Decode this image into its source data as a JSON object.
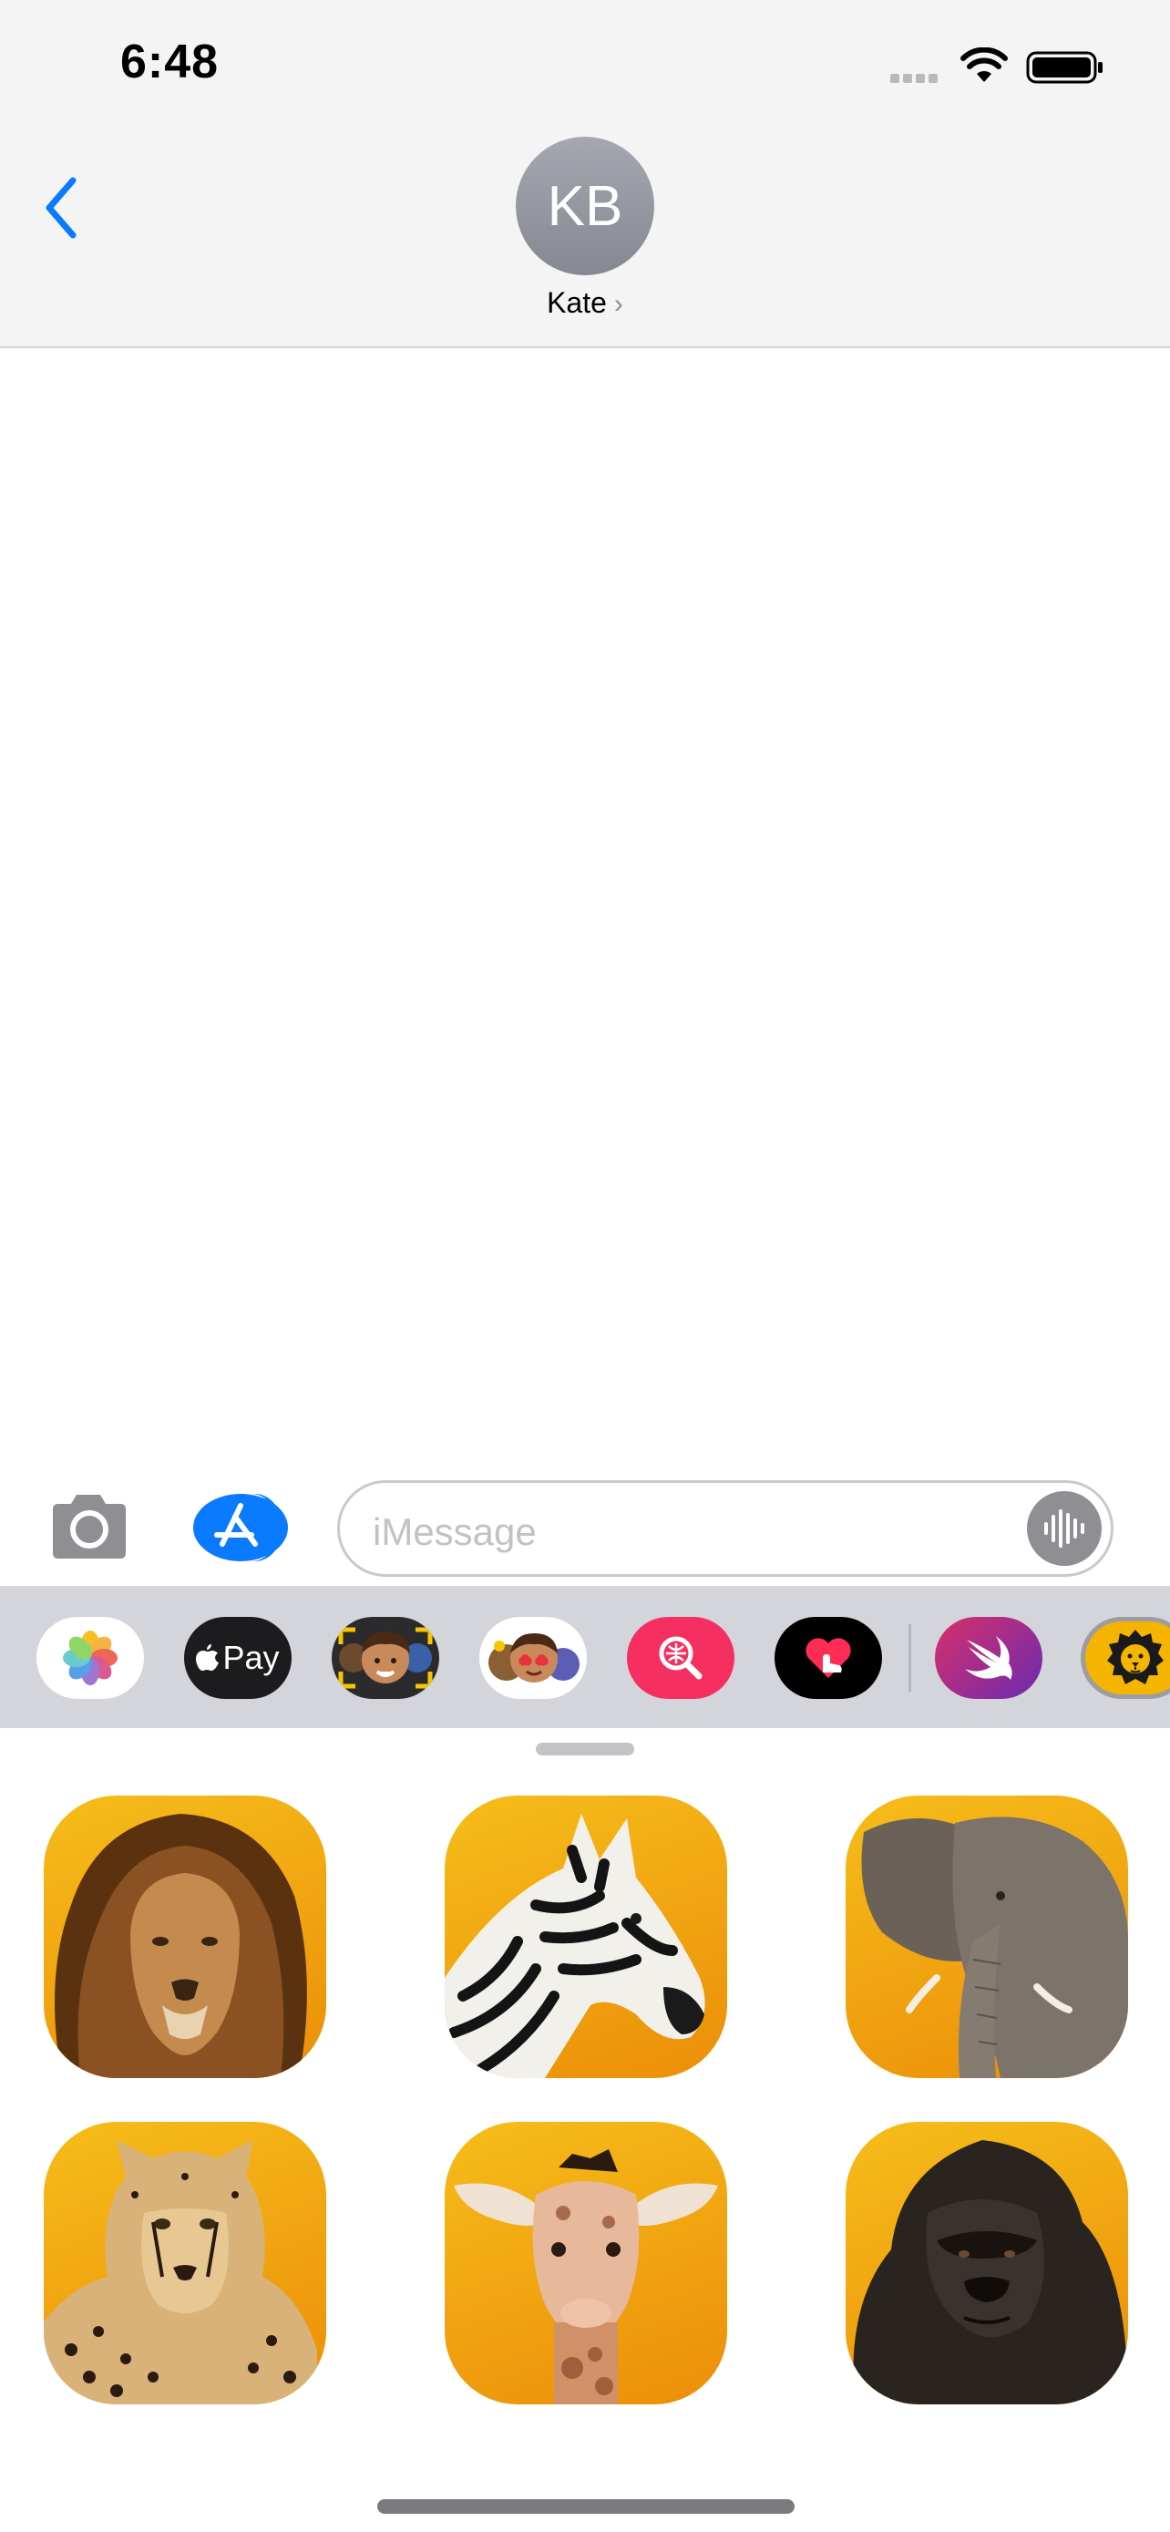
{
  "status_bar": {
    "time": "6:48",
    "signal_icon": "cellular-signal-icon",
    "wifi_icon": "wifi-icon",
    "battery_icon": "battery-icon"
  },
  "header": {
    "back_icon": "chevron-left-icon",
    "avatar_initials": "KB",
    "contact_name": "Kate",
    "contact_chevron": "›"
  },
  "input_bar": {
    "camera_icon": "camera-icon",
    "apps_icon": "app-store-icon",
    "placeholder": "iMessage",
    "audio_icon": "waveform-icon"
  },
  "app_strip": {
    "items": [
      {
        "name": "Photos",
        "icon": "photos-icon"
      },
      {
        "name": "Apple Pay",
        "label": "Pay",
        "icon": "apple-pay-icon"
      },
      {
        "name": "Memoji Stickers",
        "icon": "memoji-icon"
      },
      {
        "name": "Animoji",
        "icon": "animoji-icon"
      },
      {
        "name": "Images",
        "icon": "image-search-icon"
      },
      {
        "name": "Digital Touch",
        "icon": "digital-touch-icon"
      },
      {
        "name": "Swift",
        "icon": "swift-icon"
      },
      {
        "name": "Animal Stickers",
        "icon": "lion-icon"
      }
    ]
  },
  "stickers": [
    {
      "animal": "lion",
      "icon": "lion-sticker"
    },
    {
      "animal": "zebra",
      "icon": "zebra-sticker"
    },
    {
      "animal": "elephant",
      "icon": "elephant-sticker"
    },
    {
      "animal": "cheetah",
      "icon": "cheetah-sticker"
    },
    {
      "animal": "giraffe",
      "icon": "giraffe-sticker"
    },
    {
      "animal": "gorilla",
      "icon": "gorilla-sticker"
    }
  ],
  "colors": {
    "accent_blue": "#0a7aff",
    "sticker_gold": "#f0a310",
    "bar_gray": "#f4f4f4",
    "strip_gray": "#d4d5da"
  }
}
